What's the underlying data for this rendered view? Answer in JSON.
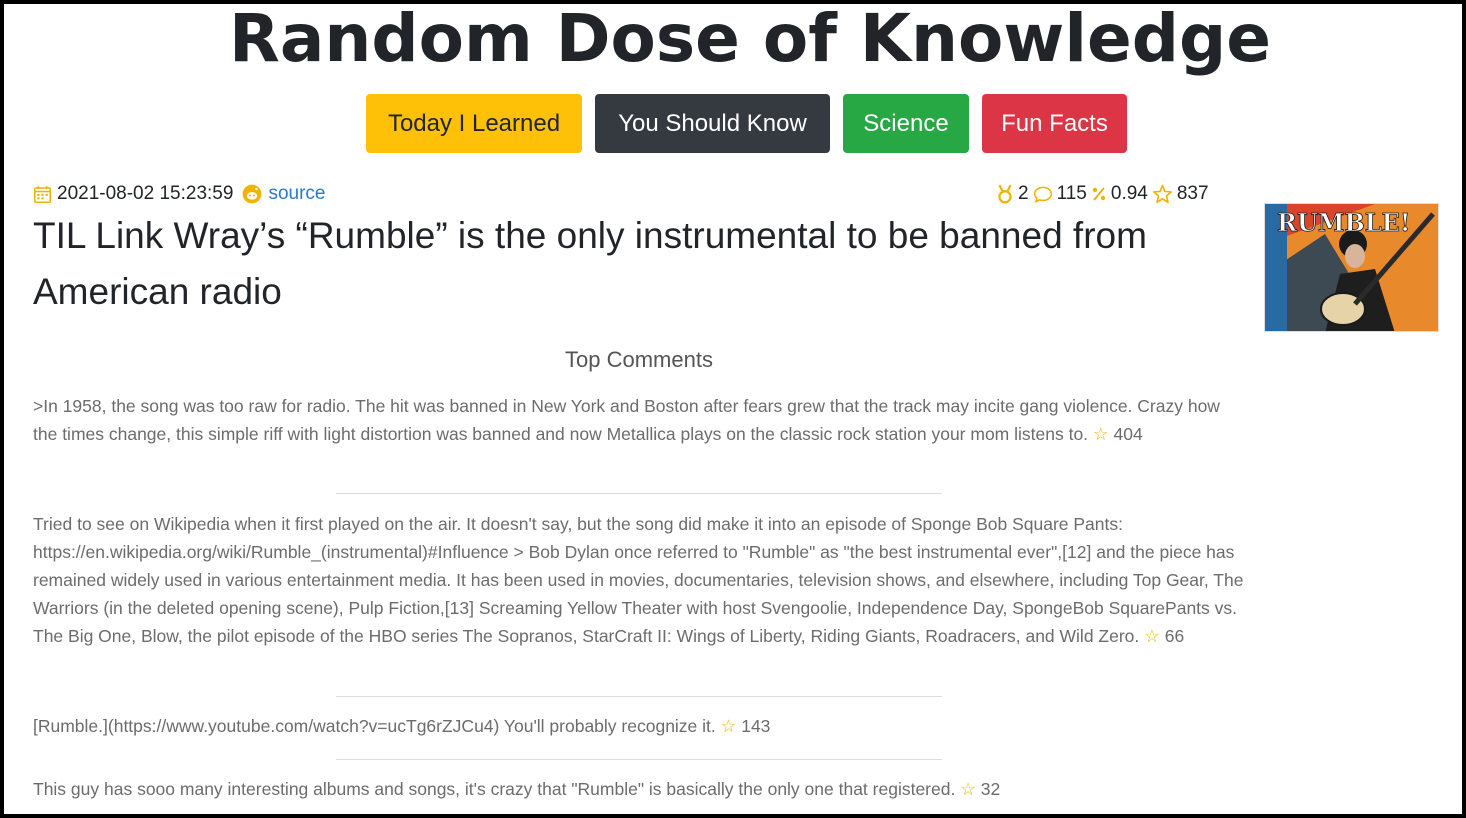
{
  "site": {
    "title": "Random Dose of Knowledge"
  },
  "nav": {
    "til": "Today I Learned",
    "ysk": "You Should Know",
    "science": "Science",
    "fun": "Fun Facts"
  },
  "post": {
    "date": "2021-08-02 15:23:59",
    "source": "source",
    "awards": "2",
    "comments": "115",
    "ratio": "0.94",
    "score": "837",
    "title": "TIL Link Wray’s “Rumble” is the only instrumental to be banned from American radio",
    "thumbnail_text": "RUMBLE!"
  },
  "comments_section": {
    "heading": "Top Comments",
    "items": [
      {
        "text": ">In 1958, the song was too raw for radio. The hit was banned in New York and Boston after fears grew that the track may incite gang violence. Crazy how the times change, this simple riff with light distortion was banned and now Metallica plays on the classic rock station your mom listens to.",
        "score": "404"
      },
      {
        "text": "Tried to see on Wikipedia when it first played on the air. It doesn't say, but the song did make it into an episode of Sponge Bob Square Pants: https://en.wikipedia.org/wiki/Rumble_(instrumental)#Influence > Bob Dylan once referred to \"Rumble\" as \"the best instrumental ever\",[12] and the piece has remained widely used in various entertainment media. It has been used in movies, documentaries, television shows, and elsewhere, including Top Gear, The Warriors (in the deleted opening scene), Pulp Fiction,[13] Screaming Yellow Theater with host Svengoolie, Independence Day, SpongeBob SquarePants vs. The Big One, Blow, the pilot episode of the HBO series The Sopranos, StarCraft II: Wings of Liberty, Riding Giants, Roadracers, and Wild Zero.",
        "score": "66"
      },
      {
        "text": "[Rumble.](https://www.youtube.com/watch?v=ucTg6rZJCu4) You'll probably recognize it.",
        "score": "143"
      },
      {
        "text": "This guy has sooo many interesting albums and songs, it's crazy that \"Rumble\" is basically the only one that registered.",
        "score": "32"
      }
    ]
  },
  "colors": {
    "til": "#ffc107",
    "ysk": "#343a40",
    "science": "#28a745",
    "fun": "#dc3545",
    "icon": "#f0b400",
    "link": "#2a7ac8"
  },
  "icons": [
    "calendar-icon",
    "reddit-icon",
    "medal-icon",
    "comment-icon",
    "percent-icon",
    "star-icon"
  ]
}
